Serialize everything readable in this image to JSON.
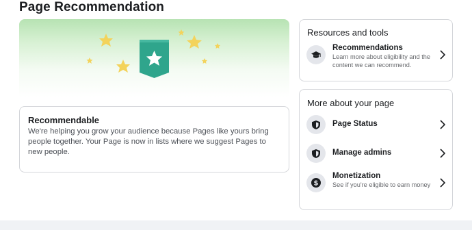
{
  "page": {
    "title": "Page Recommendation"
  },
  "status_card": {
    "title": "Recommendable",
    "body": "We're helping you grow your audience because Pages like yours bring people together. Your Page is now in lists where we suggest Pages to new people."
  },
  "resources": {
    "heading": "Resources and tools",
    "items": [
      {
        "icon": "graduation-cap-icon",
        "title": "Recommendations",
        "subtitle": "Learn more about eligibility and the content we can recommend."
      }
    ]
  },
  "more": {
    "heading": "More about your page",
    "items": [
      {
        "icon": "shield-icon",
        "title": "Page Status",
        "subtitle": ""
      },
      {
        "icon": "shield-icon",
        "title": "Manage admins",
        "subtitle": ""
      },
      {
        "icon": "dollar-icon",
        "title": "Monetization",
        "subtitle": "See if you're eligible to earn money"
      }
    ]
  },
  "colors": {
    "accent_green": "#2eab8a",
    "star_yellow": "#f6d45d",
    "border": "#d4d6da"
  }
}
